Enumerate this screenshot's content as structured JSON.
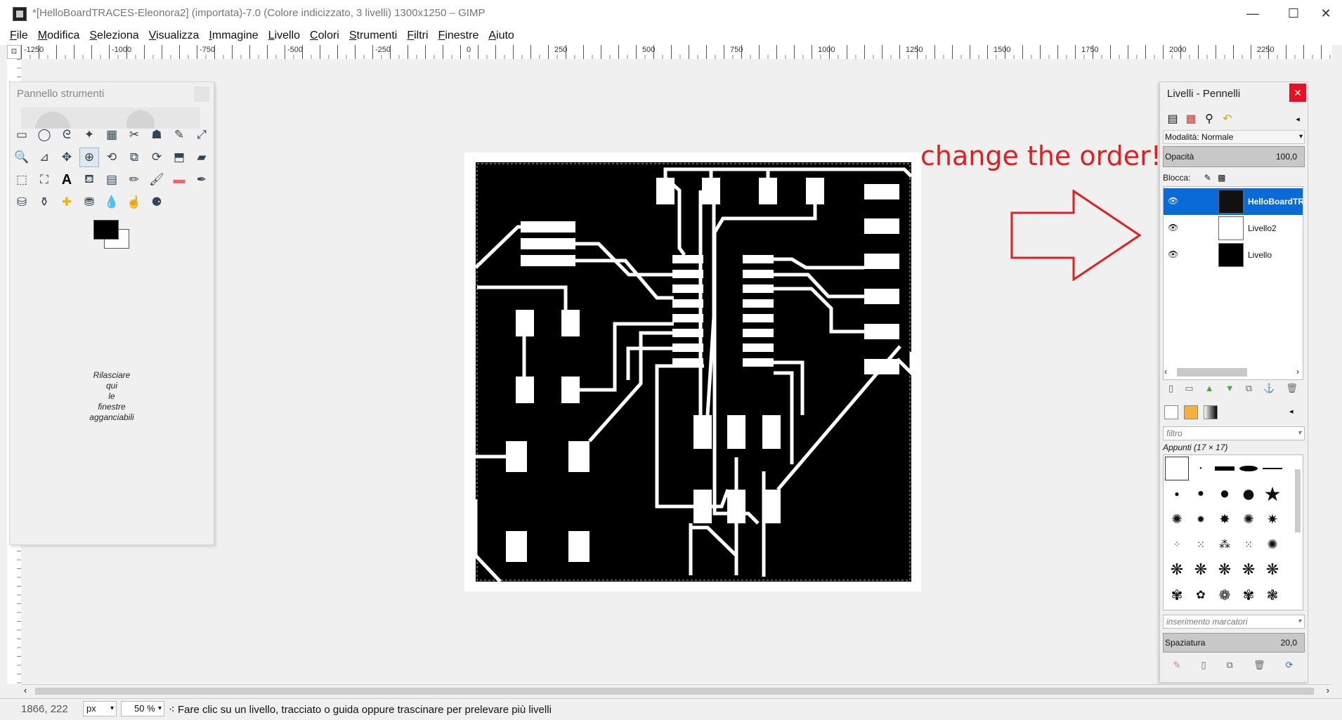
{
  "window": {
    "title": "*[HelloBoardTRACES-Eleonora2] (importata)-7.0 (Colore indicizzato, 3 livelli) 1300x1250 – GIMP",
    "minimize_glyph": "—",
    "maximize_glyph": "☐",
    "close_glyph": "✕"
  },
  "menu": [
    "File",
    "Modifica",
    "Seleziona",
    "Visualizza",
    "Immagine",
    "Livello",
    "Colori",
    "Strumenti",
    "Filtri",
    "Finestre",
    "Aiuto"
  ],
  "ruler": {
    "labels": [
      "-1250",
      "-1000",
      "-750",
      "-500",
      "-250",
      "0",
      "250",
      "500",
      "750",
      "1000",
      "1250",
      "1500",
      "1750",
      "2000",
      "2250"
    ]
  },
  "toolbox": {
    "title": "Pannello strumenti",
    "dock_hint": [
      "Rilasciare",
      "qui",
      "le",
      "finestre",
      "agganciabili"
    ],
    "tools": [
      "rect-select",
      "ellipse-select",
      "lasso",
      "fuzzy-select",
      "by-color-select",
      "scissors",
      "foreground-select",
      "paths",
      "color-picker",
      "zoom",
      "measure",
      "move",
      "align",
      "transform",
      "crop",
      "rotate",
      "scale",
      "shear",
      "flip",
      "cage",
      "text",
      "bucket-fill",
      "blend",
      "pencil",
      "paintbrush",
      "eraser",
      "airbrush",
      "ink",
      "clone",
      "heal",
      "perspective-clone",
      "blur",
      "smudge",
      "dodge"
    ]
  },
  "annotation": {
    "text": "change the order!",
    "color": "#e02020"
  },
  "layers_panel": {
    "title": "Livelli - Pennelli",
    "mode_label": "Modalità: Normale",
    "opacity_label": "Opacità",
    "opacity_value": "100,0",
    "lock_label": "Blocca:",
    "layers": [
      {
        "name": "HelloBoardTRACES",
        "selected": true
      },
      {
        "name": "Livello2",
        "selected": false
      },
      {
        "name": "Livello",
        "selected": false
      }
    ],
    "filter_placeholder": "filtro",
    "brush_set_label": "Appunti (17 × 17)",
    "tag_placeholder": "inserimento marcatori",
    "spacing_label": "Spaziatura",
    "spacing_value": "20,0"
  },
  "statusbar": {
    "coords": "1866, 222",
    "unit": "px",
    "zoom": "50 %",
    "message": "Fare clic su un livello, tracciato o guida oppure trascinare per prelevare più livelli"
  },
  "colors": {
    "selection_blue": "#0a6bd8",
    "close_red": "#e81123"
  }
}
